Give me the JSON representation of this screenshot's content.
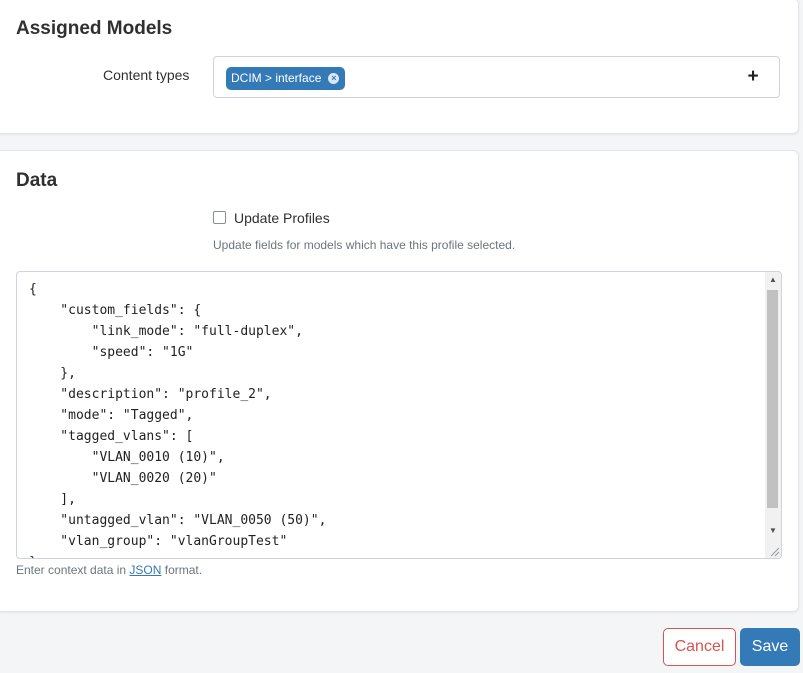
{
  "assigned_models": {
    "title": "Assigned Models",
    "content_types_label": "Content types",
    "selected_chip": "DCIM > interface",
    "add_label": "+"
  },
  "data_section": {
    "title": "Data",
    "checkbox_label": "Update Profiles",
    "checkbox_checked": false,
    "checkbox_help": "Update fields for models which have this profile selected.",
    "code_lines": [
      "{",
      "    \"custom_fields\": {",
      "        \"link_mode\": \"full-duplex\",",
      "        \"speed\": \"1G\"",
      "    },",
      "    \"description\": \"profile_2\",",
      "    \"mode\": \"Tagged\",",
      "    \"tagged_vlans\": [",
      "        \"VLAN_0010 (10)\",",
      "        \"VLAN_0020 (20)\"",
      "    ],",
      "    \"untagged_vlan\": \"VLAN_0050 (50)\",",
      "    \"vlan_group\": \"vlanGroupTest\"",
      "}"
    ],
    "help_prefix": "Enter context data in ",
    "help_link": "JSON",
    "help_suffix": " format."
  },
  "actions": {
    "cancel_label": "Cancel",
    "save_label": "Save"
  },
  "colors": {
    "accent": "#337ab7",
    "danger": "#d9534f"
  }
}
